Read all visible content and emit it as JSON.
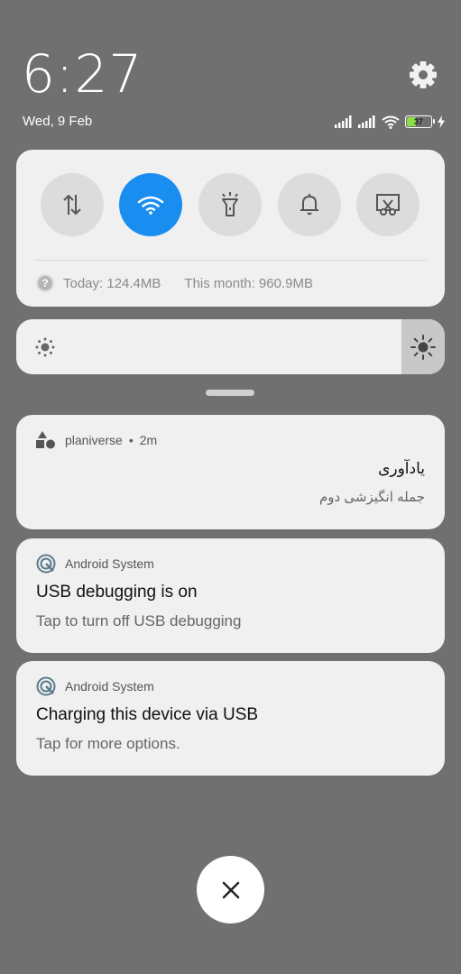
{
  "status": {
    "time": "6:27",
    "date": "Wed, 9 Feb",
    "battery_level": "37",
    "battery_fraction": 0.37
  },
  "quick_settings": {
    "toggles": [
      {
        "name": "Mobile data",
        "icon": "mobile-data-icon",
        "active": false
      },
      {
        "name": "Wi-Fi",
        "icon": "wifi-icon",
        "active": true
      },
      {
        "name": "Flashlight",
        "icon": "flashlight-icon",
        "active": false
      },
      {
        "name": "Sound",
        "icon": "bell-icon",
        "active": false
      },
      {
        "name": "Screenshot",
        "icon": "screenshot-icon",
        "active": false
      }
    ],
    "data_today": "Today: 124.4MB",
    "data_month": "This month: 960.9MB",
    "active_color": "#1a8ef0"
  },
  "brightness": {
    "level": 1.0
  },
  "notifications": [
    {
      "app": "planiverse",
      "time": "2m",
      "title": "یادآوری",
      "text": "جمله انگیزشی دوم",
      "icon": "planiverse-app-icon"
    },
    {
      "app": "Android System",
      "title": "USB debugging is on",
      "text": "Tap to turn off USB debugging",
      "icon": "android-system-icon"
    },
    {
      "app": "Android System",
      "title": "Charging this device via USB",
      "text": "Tap for more options.",
      "icon": "android-system-icon"
    }
  ],
  "clear_button": {
    "icon": "close-icon"
  }
}
